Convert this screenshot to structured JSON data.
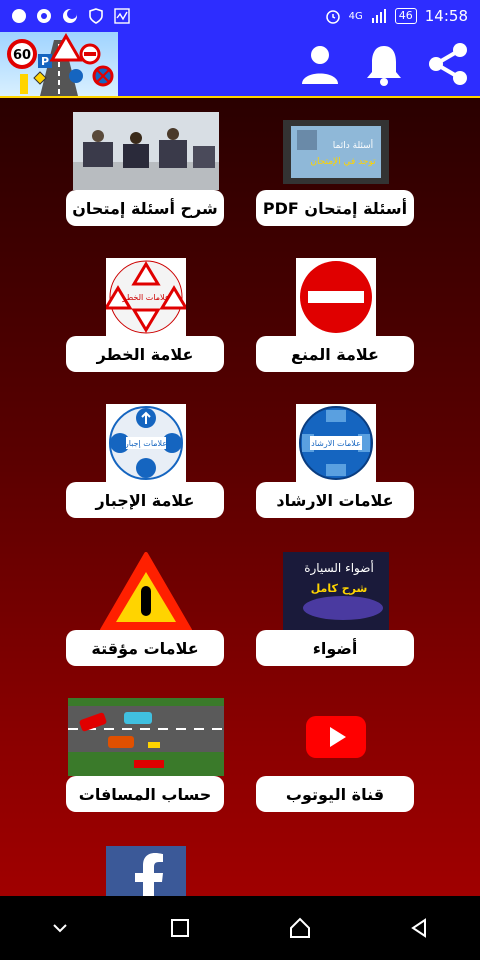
{
  "statusbar": {
    "network": "4G",
    "battery": "46",
    "time": "14:58"
  },
  "appbar": {
    "logo_speed": "60",
    "logo_parking": "P"
  },
  "grid": [
    {
      "id": "pdf",
      "label": "أسئلة إمتحان PDF",
      "thumb_text_top": "أسئلة دائما",
      "thumb_text_bottom": "توجد في الإمتحان"
    },
    {
      "id": "explain",
      "label": "شرح أسئلة إمتحان"
    },
    {
      "id": "prohibition",
      "label": "علامة المنع"
    },
    {
      "id": "danger",
      "label": "علامة الخطر",
      "thumb_text": "علامات الخطر"
    },
    {
      "id": "guidance",
      "label": "علامات الارشاد",
      "thumb_text": "علامات الارشاد"
    },
    {
      "id": "mandatory",
      "label": "علامة الإجبار",
      "thumb_text": "علامات إجبار"
    },
    {
      "id": "lights",
      "label": "أضواء",
      "thumb_text_top": "أضواء السيارة",
      "thumb_text_bottom": "شرح كامل"
    },
    {
      "id": "temporary",
      "label": "علامات مؤقتة"
    },
    {
      "id": "youtube",
      "label": "قناة اليوتوب"
    },
    {
      "id": "distances",
      "label": "حساب المسافات"
    }
  ],
  "colors": {
    "bar": "#2d2dff",
    "accent": "#ffd400",
    "sign_red": "#e00000",
    "youtube": "#ff0000",
    "facebook": "#3b5998"
  }
}
